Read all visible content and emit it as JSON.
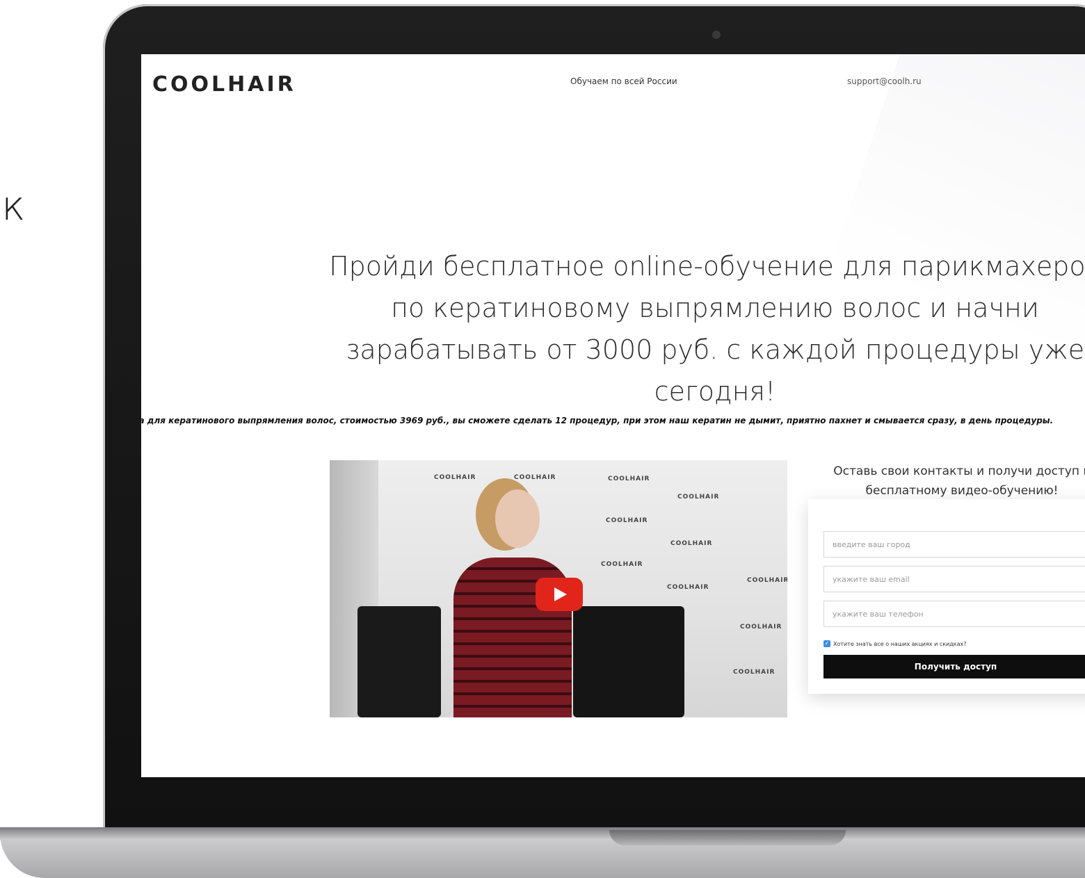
{
  "side_text": "к",
  "header": {
    "logo": "COOLHAIR",
    "tagline": "Обучаем по всей России",
    "email": "support@coolh.ru"
  },
  "hero": {
    "title": "Пройди бесплатное online-обучение для парикмахеров по кератиновому выпрямлению волос и начни зарабатывать от 3000 руб. с каждой процедуры уже сегодня!",
    "subtitle_line1": "С одного набора для кератинового выпрямления волос, стоимостью 3969 руб., вы сможете сделать 12 процедур, при этом наш кератин не дымит, приятно пахнет и смывается сразу, в день процедуры.",
    "subtitle_line2": ""
  },
  "video": {
    "backdrop_text": "COOLHAIR",
    "play_icon": "youtube-play-icon",
    "play_color": "#e1251b"
  },
  "form": {
    "heading": "Оставь свои контакты и получи доступ к бесплатному видео-обучению!",
    "city_placeholder": "введите ваш город",
    "email_placeholder": "укажите ваш email",
    "phone_placeholder": "укажите ваш телефон",
    "checkbox_label": "Хотите знать все о наших акциях и скидках?",
    "checkbox_checked": true,
    "submit_label": "Получить доступ"
  }
}
